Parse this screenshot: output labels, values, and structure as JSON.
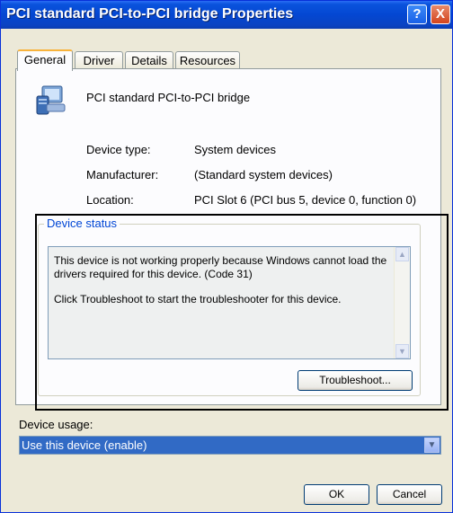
{
  "window": {
    "title": "PCI standard PCI-to-PCI bridge Properties",
    "help_glyph": "?",
    "close_glyph": "X"
  },
  "tabs": [
    {
      "label": "General"
    },
    {
      "label": "Driver"
    },
    {
      "label": "Details"
    },
    {
      "label": "Resources"
    }
  ],
  "device": {
    "name": "PCI standard PCI-to-PCI bridge",
    "icon": "computer-device-icon"
  },
  "properties": [
    {
      "label": "Device type:",
      "value": "System devices"
    },
    {
      "label": "Manufacturer:",
      "value": "(Standard system devices)"
    },
    {
      "label": "Location:",
      "value": "PCI Slot 6 (PCI bus 5, device 0, function 0)"
    }
  ],
  "device_status": {
    "legend": "Device status",
    "line1": "This device is not working properly because Windows cannot load the drivers required for this device. (Code 31)",
    "line2": "Click Troubleshoot to start the troubleshooter for this device.",
    "troubleshoot_label": "Troubleshoot..."
  },
  "device_usage": {
    "label": "Device usage:",
    "selected": "Use this device (enable)"
  },
  "footer": {
    "ok_label": "OK",
    "cancel_label": "Cancel"
  },
  "colors": {
    "titlebar": "#0447d2",
    "dialog_bg": "#ece9d8",
    "selection": "#316ac5",
    "highlight_border": "#000000"
  }
}
